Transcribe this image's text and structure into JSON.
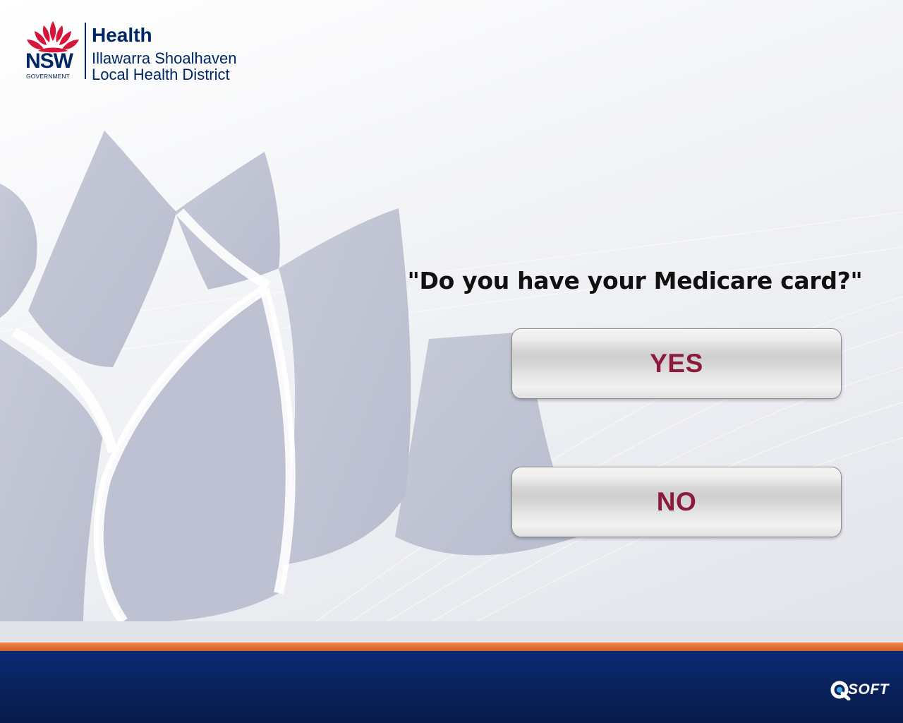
{
  "branding": {
    "nsw": "NSW",
    "government": "GOVERNMENT",
    "health": "Health",
    "district_line1": "Illawarra Shoalhaven",
    "district_line2": "Local Health District",
    "vendor": "SOFT"
  },
  "prompt": {
    "question": "\"Do you have your Medicare card?\""
  },
  "buttons": {
    "yes_label": "YES",
    "no_label": "NO"
  },
  "colors": {
    "brand_navy": "#002664",
    "brand_red": "#d7153a",
    "button_text": "#8c1a3c",
    "stripe_orange": "#e0702f",
    "footer_blue": "#0a2460"
  },
  "icons": {
    "logo": "waratah-flower-icon",
    "background": "waratah-watermark",
    "vendor_mark": "qsoft-q-icon"
  }
}
